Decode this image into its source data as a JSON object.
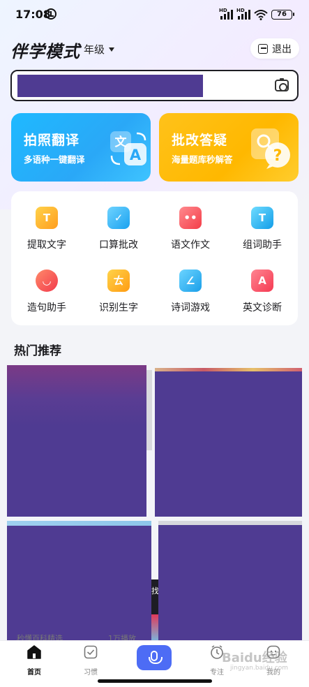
{
  "status_bar": {
    "time": "17:08",
    "battery": "76",
    "hd1": "HD",
    "hd2": "HD"
  },
  "header": {
    "title": "伴学模式",
    "grade": "年级",
    "exit_label": "退出"
  },
  "search": {
    "placeholder": ""
  },
  "banners": [
    {
      "title": "拍照翻译",
      "subtitle": "多语种一键翻译",
      "icon": "translate-icon"
    },
    {
      "title": "批改答疑",
      "subtitle": "海量题库秒解答",
      "icon": "question-bubble-icon"
    }
  ],
  "tools": [
    {
      "label": "提取文字",
      "icon": "extract-text-icon",
      "glyph": "T",
      "color": "#ffb12a"
    },
    {
      "label": "口算批改",
      "icon": "check-card-icon",
      "glyph": "✓",
      "color": "#2bb2f5"
    },
    {
      "label": "语文作文",
      "icon": "composition-face-icon",
      "glyph": "••",
      "color": "#fb5a5f"
    },
    {
      "label": "组词助手",
      "icon": "word-helper-icon",
      "glyph": "T",
      "color": "#26b8f3"
    },
    {
      "label": "造句助手",
      "icon": "sentence-smile-icon",
      "glyph": "◡",
      "color": "#fb4e55"
    },
    {
      "label": "识别生字",
      "icon": "recognize-char-icon",
      "glyph": "ㄊ",
      "color": "#ffae1e"
    },
    {
      "label": "诗词游戏",
      "icon": "poetry-game-icon",
      "glyph": "∠",
      "color": "#2cb3f2"
    },
    {
      "label": "英文诊断",
      "icon": "english-diagnosis-icon",
      "glyph": "A",
      "color": "#ff4d5f"
    }
  ],
  "section": {
    "title": "热门推荐"
  },
  "feed_behind": {
    "left_text": "秒懂百科精选",
    "right_text": "1万播放",
    "side_char": "找"
  },
  "bottom_nav": [
    {
      "label": "首页",
      "icon": "home-icon",
      "active": true
    },
    {
      "label": "习惯",
      "icon": "habit-check-icon",
      "active": false
    },
    {
      "label": "",
      "icon": "mic-icon",
      "active": false
    },
    {
      "label": "专注",
      "icon": "focus-clock-icon",
      "active": false
    },
    {
      "label": "我的",
      "icon": "profile-face-icon",
      "active": false
    }
  ],
  "watermark": {
    "text": "Baidu经验",
    "sub": "jingyan.baidu.com"
  }
}
